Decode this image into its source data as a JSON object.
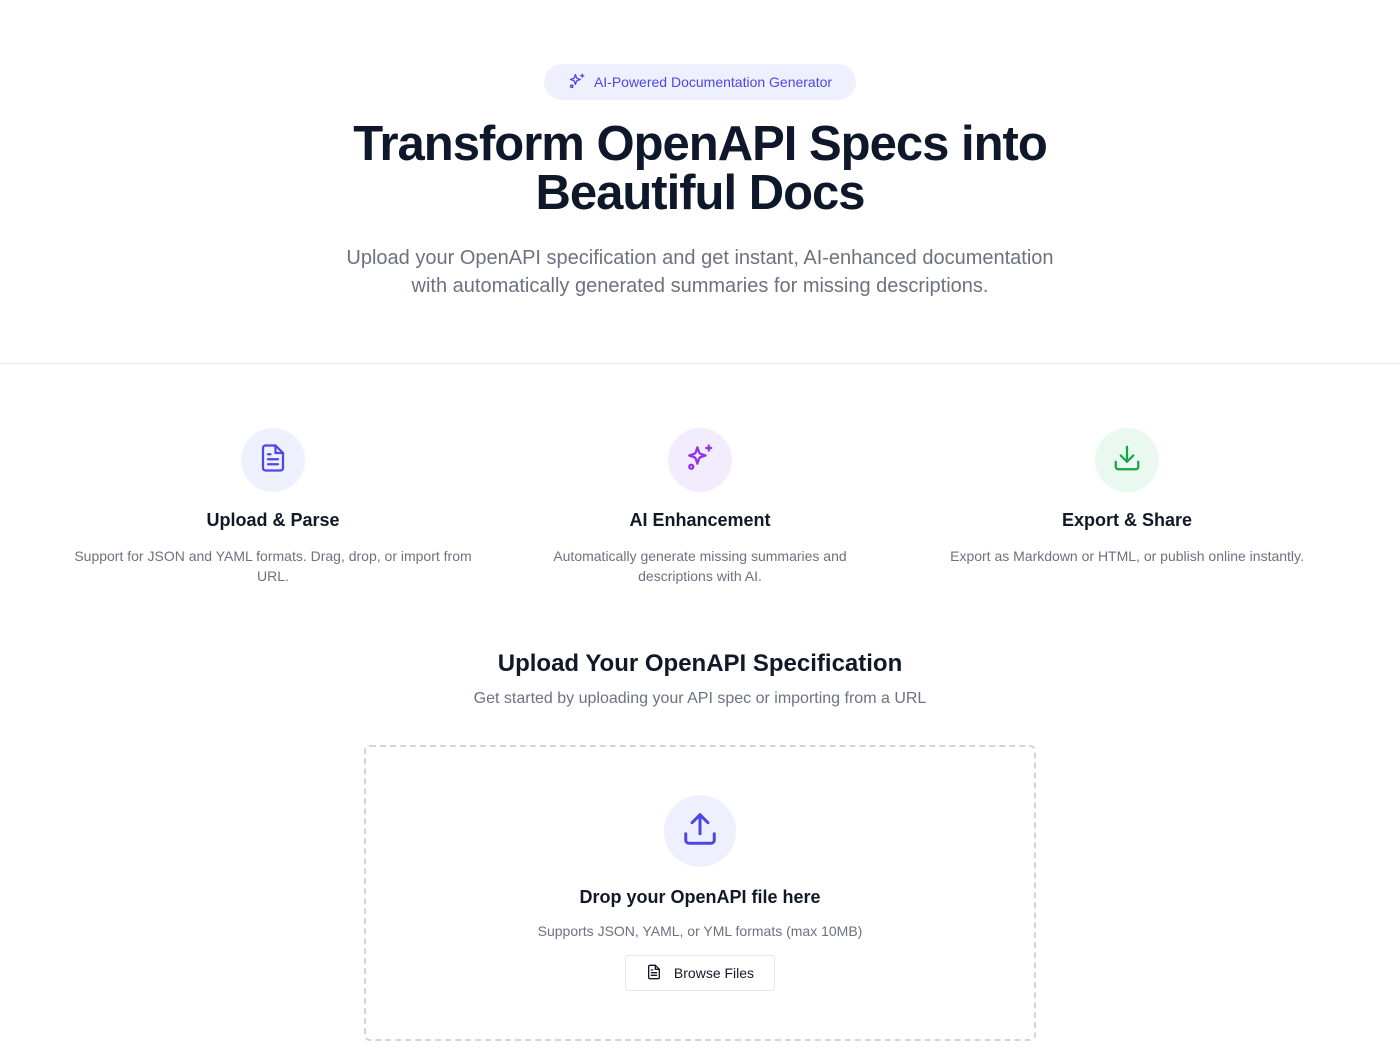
{
  "hero": {
    "badge_icon": "sparkles-icon",
    "badge": "AI-Powered Documentation Generator",
    "title_line1": "Transform OpenAPI Specs into",
    "title_line2": "Beautiful Docs",
    "subtitle_line1": "Upload your OpenAPI specification and get instant, AI-enhanced documentation",
    "subtitle_line2": "with automatically generated summaries for missing descriptions."
  },
  "features": [
    {
      "icon": "file-text-icon",
      "title": "Upload & Parse",
      "description": "Support for JSON and YAML formats. Drag, drop, or import from URL.",
      "icon_color": "#4f46e5",
      "bg_color": "#eef0fe"
    },
    {
      "icon": "sparkles-icon",
      "title": "AI Enhancement",
      "description": "Automatically generate missing summaries and descriptions with AI.",
      "icon_color": "#9333ea",
      "bg_color": "#f3ecfd"
    },
    {
      "icon": "download-icon",
      "title": "Export & Share",
      "description": "Export as Markdown or HTML, or publish online instantly.",
      "icon_color": "#16a34a",
      "bg_color": "#e9f9ef"
    }
  ],
  "upload": {
    "title": "Upload Your OpenAPI Specification",
    "subtitle": "Get started by uploading your API spec or importing from a URL",
    "dropzone_icon": "upload-icon",
    "dropzone_title": "Drop your OpenAPI file here",
    "dropzone_subtitle": "Supports JSON, YAML, or YML formats (max 10MB)",
    "browse_icon": "file-text-icon",
    "browse_label": "Browse Files"
  },
  "colors": {
    "accent": "#4f46e5",
    "accent_bg": "#eef0fe"
  }
}
